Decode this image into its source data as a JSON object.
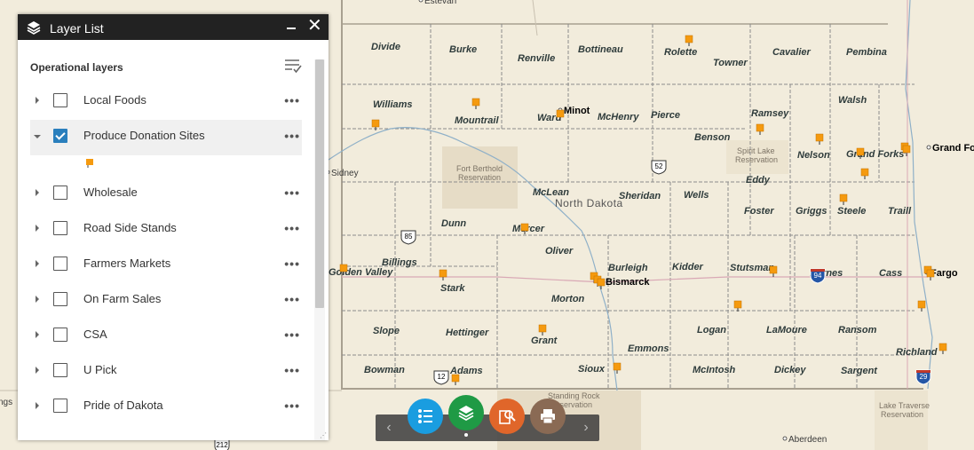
{
  "panel": {
    "title": "Layer List",
    "section_label": "Operational layers",
    "layers": [
      {
        "name": "Local Foods",
        "checked": false,
        "expanded": false
      },
      {
        "name": "Produce Donation Sites",
        "checked": true,
        "expanded": true
      },
      {
        "name": "Wholesale",
        "checked": false,
        "expanded": false
      },
      {
        "name": "Road Side Stands",
        "checked": false,
        "expanded": false
      },
      {
        "name": "Farmers Markets",
        "checked": false,
        "expanded": false
      },
      {
        "name": "On Farm Sales",
        "checked": false,
        "expanded": false
      },
      {
        "name": "CSA",
        "checked": false,
        "expanded": false
      },
      {
        "name": "U Pick",
        "checked": false,
        "expanded": false
      },
      {
        "name": "Pride of Dakota",
        "checked": false,
        "expanded": false
      }
    ],
    "more_glyph": "•••"
  },
  "map": {
    "state_label": "North Dakota",
    "counties": [
      "Divide",
      "Burke",
      "Renville",
      "Bottineau",
      "Rolette",
      "Towner",
      "Cavalier",
      "Pembina",
      "Williams",
      "Mountrail",
      "Ward",
      "McHenry",
      "Pierce",
      "Ramsey",
      "Walsh",
      "Benson",
      "Nelson",
      "Grand Forks",
      "Eddy",
      "McLean",
      "Sheridan",
      "Wells",
      "Foster",
      "Griggs",
      "Steele",
      "Traill",
      "Dunn",
      "Mercer",
      "Oliver",
      "Billings",
      "Golden Valley",
      "Stark",
      "Burleigh",
      "Kidder",
      "Stutsman",
      "Barnes",
      "Cass",
      "Morton",
      "Slope",
      "Hettinger",
      "Grant",
      "Emmons",
      "Logan",
      "LaMoure",
      "Ransom",
      "Richland",
      "Bowman",
      "Adams",
      "Sioux",
      "McIntosh",
      "Dickey",
      "Sargent"
    ],
    "cities": [
      "Minot",
      "Grand Forks",
      "Bismarck",
      "Fargo",
      "Sidney",
      "Aberdeen",
      "Estevan"
    ],
    "reservations": [
      "Fort Berthold Reservation",
      "Spirit Lake Reservation",
      "Standing Rock Reservation",
      "Lake Traverse Reservation"
    ],
    "highways": [
      "85",
      "52",
      "94",
      "94",
      "29",
      "12",
      "212"
    ],
    "edge_labels": [
      "ngs"
    ],
    "marker_color": "#f59a0f"
  },
  "toolbar": {
    "prev": "‹",
    "next": "›",
    "colors": {
      "legend": "#1a9de0",
      "layers": "#1f9a45",
      "query": "#e0662a",
      "print": "#8a6a54"
    }
  }
}
